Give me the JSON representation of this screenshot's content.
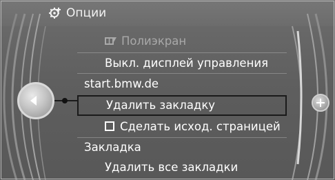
{
  "title": "Опции",
  "title_icon": "gear-plus-icon",
  "menu": {
    "fullscreen_label": "Полиэкран",
    "fullscreen_icon": "split-screen-icon",
    "display_off_label": "Выкл. дисплей управления",
    "site_label": "start.bmw.de",
    "delete_bookmark_label": "Удалить закладку",
    "set_homepage_label": "Сделать исход. страницей",
    "bookmark_label": "Закладка",
    "delete_all_bookmarks_label": "Удалить все закладки"
  },
  "colors": {
    "background": "#626262",
    "text": "#ffffff",
    "disabled_text": "#a9a9a9",
    "selection_border": "#1a1a1a"
  }
}
